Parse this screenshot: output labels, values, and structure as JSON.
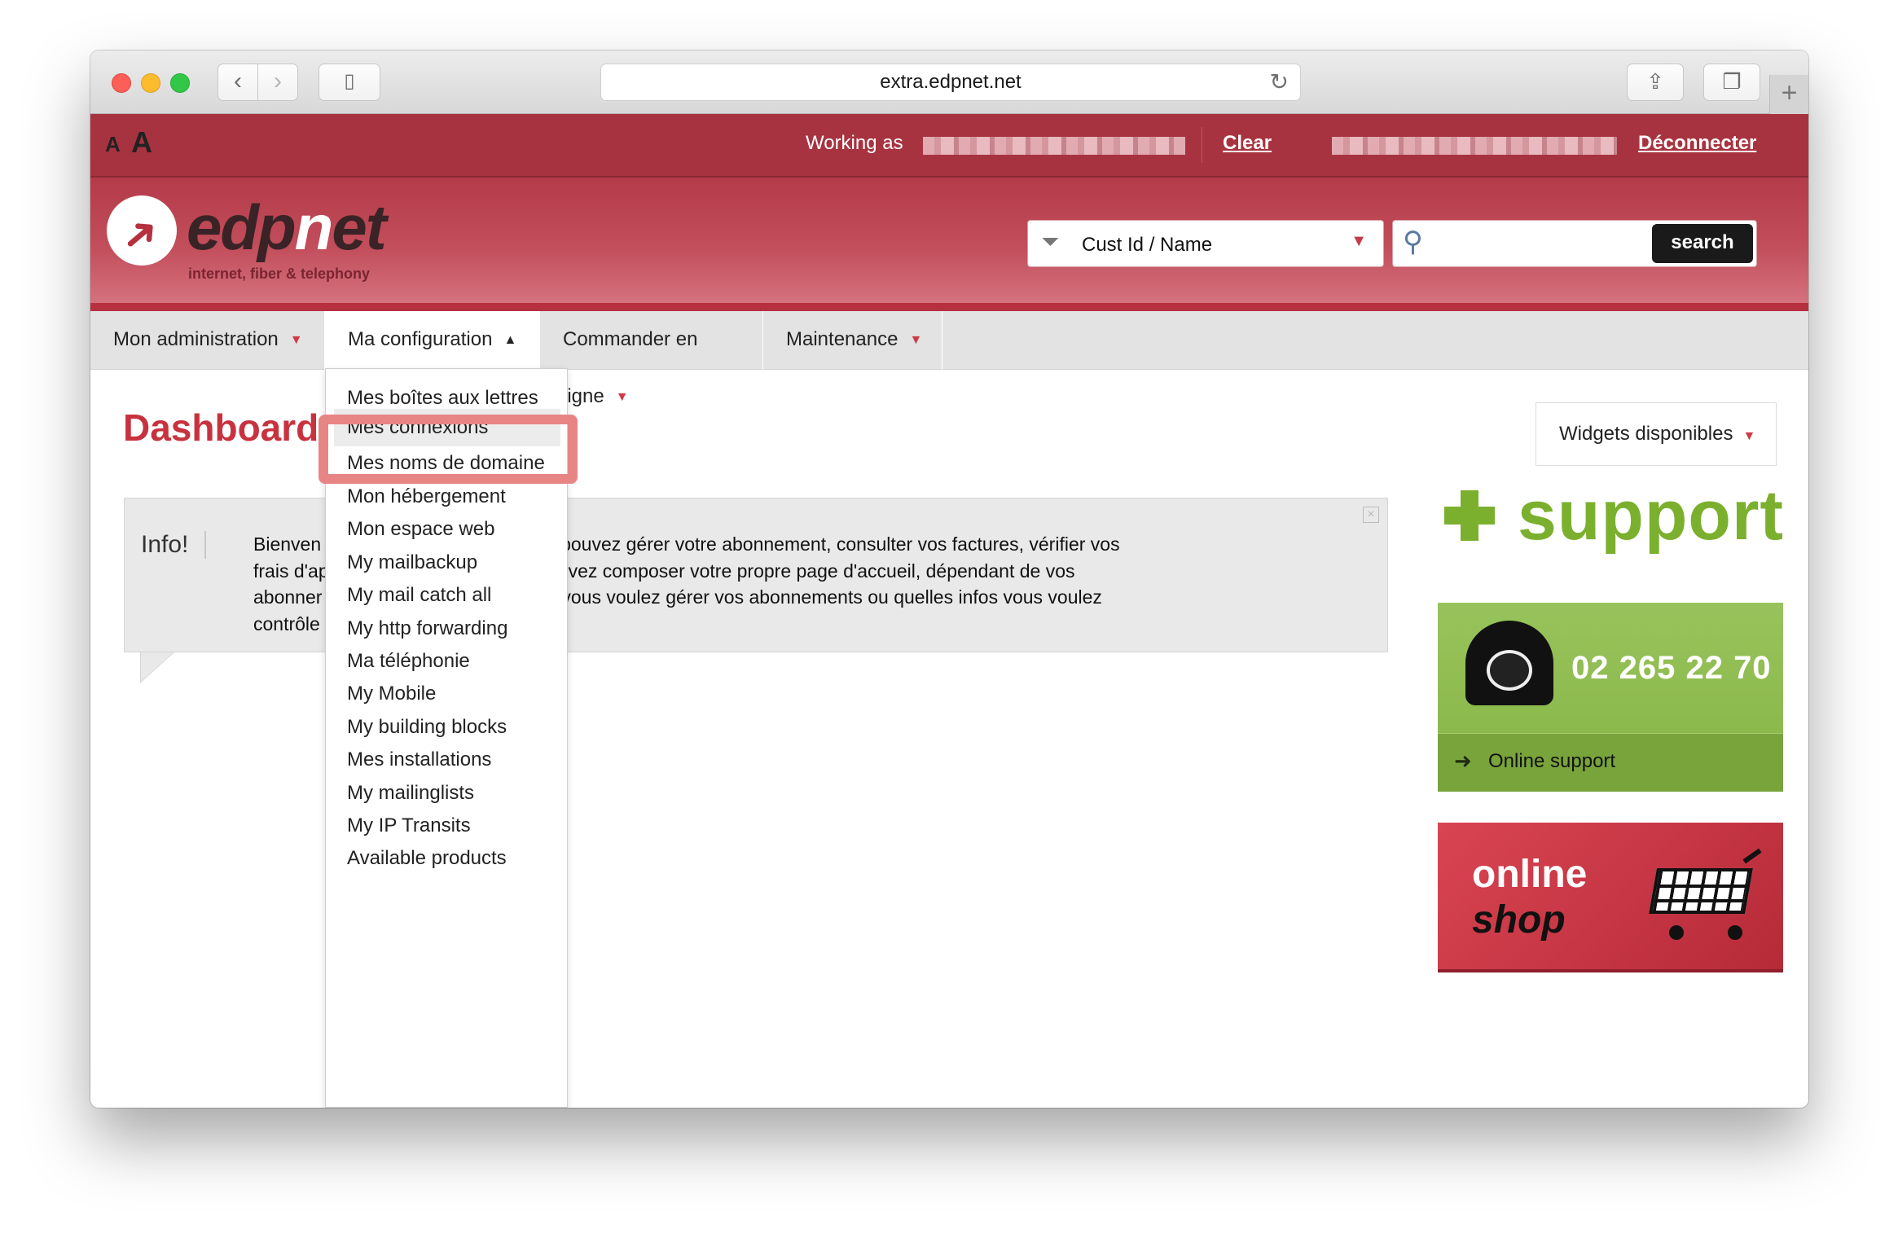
{
  "browser": {
    "url": "extra.edpnet.net"
  },
  "topbar": {
    "working_as": "Working as",
    "clear": "Clear",
    "disconnect": "Déconnecter"
  },
  "header": {
    "logo_text": "edpnet",
    "tagline": "internet, fiber & telephony",
    "filter_label": "Cust Id / Name",
    "search_placeholder": "",
    "search_button": "search"
  },
  "nav": {
    "items": [
      {
        "label": "Mon administration"
      },
      {
        "label": "Ma configuration"
      },
      {
        "label": "Commander en ligne"
      },
      {
        "label": "Maintenance"
      }
    ]
  },
  "main": {
    "title": "Dashboard",
    "info_label": "Info!",
    "info_lines": [
      "Bienven                                              pouvez gérer votre abonnement, consulter vos factures, vérifier vos",
      "frais d'ap                                            uvez composer votre propre page d'accueil, dépendant de vos",
      "abonner                                              vous voulez gérer vos abonnements ou quelles infos vous voulez",
      "contrôle"
    ]
  },
  "dropdown": {
    "items": [
      "Mes boîtes aux lettres",
      "Mes connexions",
      "Mes noms de domaine",
      "Mon hébergement",
      "Mon espace web",
      "My mailbackup",
      "My mail catch all",
      "My http forwarding",
      "Ma téléphonie",
      "My Mobile",
      "My building blocks",
      "Mes installations",
      "My mailinglists",
      "My IP Transits",
      "Available products"
    ],
    "selected_index": 1
  },
  "sidebar": {
    "widgets_label": "Widgets disponibles",
    "support_title": "support",
    "phone": "02  265 22 70",
    "online_support": "Online support",
    "shop_line1": "online",
    "shop_line2": "shop"
  },
  "colors": {
    "brand_red": "#b6303f",
    "support_green": "#7bb02e",
    "highlight": "#e78585"
  }
}
